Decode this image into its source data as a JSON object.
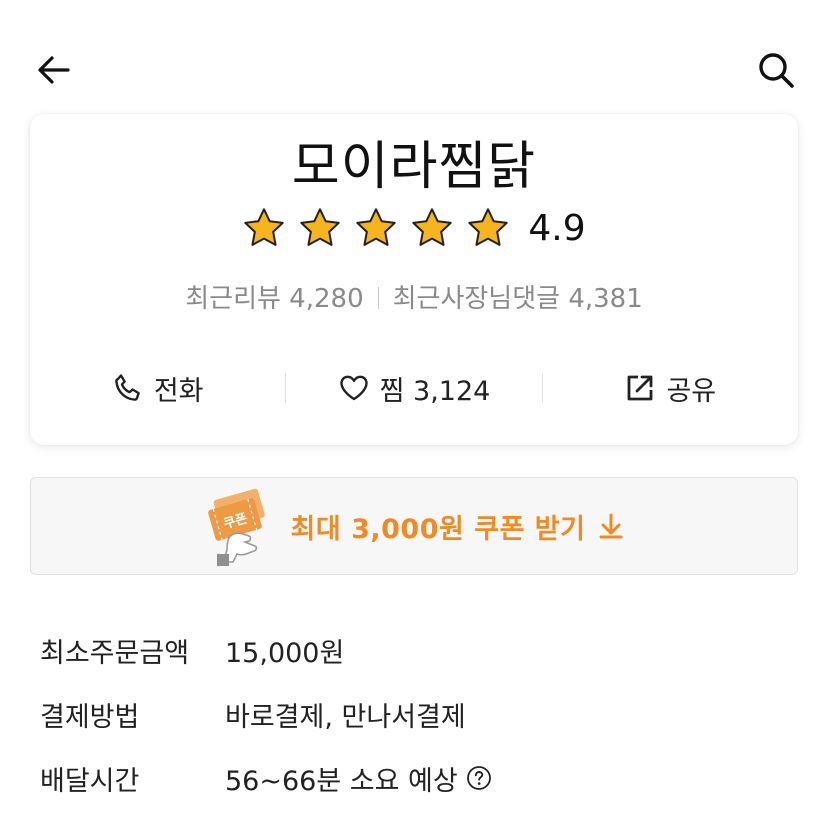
{
  "header": {
    "back_icon": "arrow-left-icon",
    "search_icon": "search-icon"
  },
  "store": {
    "name": "모이라찜닭",
    "rating": "4.9",
    "stars": 5,
    "reviews_label": "최근리뷰 4,280",
    "owner_comments_label": "최근사장님댓글 4,381"
  },
  "actions": {
    "call_label": "전화",
    "favorite_label": "찜 3,124",
    "share_label": "공유"
  },
  "coupon": {
    "badge_text": "쿠폰",
    "label": "최대 3,000원 쿠폰 받기",
    "accent": "#f08a24"
  },
  "info": [
    {
      "label": "최소주문금액",
      "value": "15,000원"
    },
    {
      "label": "결제방법",
      "value": "바로결제, 만나서결제"
    },
    {
      "label": "배달시간",
      "value": "56~66분 소요 예상"
    }
  ],
  "colors": {
    "star": "#f6b51e",
    "muted_text": "#8a8a8a"
  }
}
